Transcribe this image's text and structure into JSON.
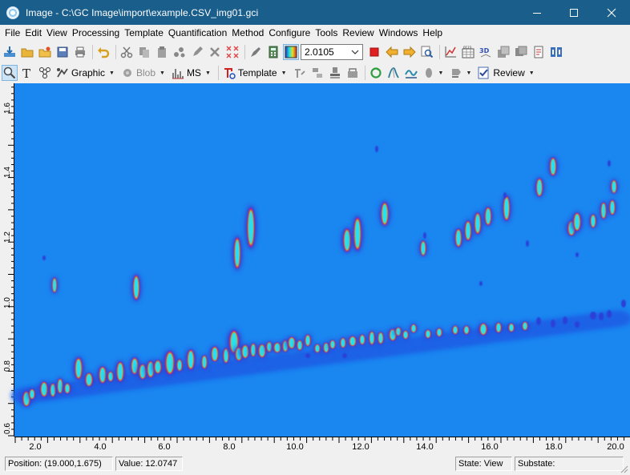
{
  "window": {
    "title": "Image - C:\\GC Image\\import\\example.CSV_img01.gci",
    "minimize_label": "─",
    "maximize_label": "☐",
    "close_label": "✕"
  },
  "menu": [
    {
      "key": "file",
      "label": "File"
    },
    {
      "key": "edit",
      "label": "Edit"
    },
    {
      "key": "view",
      "label": "View"
    },
    {
      "key": "processing",
      "label": "Processing"
    },
    {
      "key": "template",
      "label": "Template"
    },
    {
      "key": "quantification",
      "label": "Quantification"
    },
    {
      "key": "method",
      "label": "Method"
    },
    {
      "key": "configure",
      "label": "Configure"
    },
    {
      "key": "tools",
      "label": "Tools"
    },
    {
      "key": "review",
      "label": "Review"
    },
    {
      "key": "windows",
      "label": "Windows"
    },
    {
      "key": "help",
      "label": "Help"
    }
  ],
  "toolbar1": {
    "zoom_value": "2.0105"
  },
  "toolbar2": {
    "graphic_label": "Graphic",
    "blob_label": "Blob",
    "ms_label": "MS",
    "template_label": "Template",
    "review_label": "Review"
  },
  "axes": {
    "x_ticks": [
      "2.0",
      "4.0",
      "6.0",
      "8.0",
      "10.0",
      "12.0",
      "14.0",
      "16.0",
      "18.0",
      "20.0"
    ],
    "y_ticks": [
      "0.6",
      "0.8",
      "1.0",
      "1.2",
      "1.4",
      "1.6"
    ]
  },
  "colors": {
    "background": "#1a86f0",
    "title_bar": "#1a5e8c"
  },
  "status": {
    "position": "Position: (19.000,1.675)",
    "value": "Value: 12.0747",
    "state": "State: View",
    "substate": "Substate:"
  }
}
